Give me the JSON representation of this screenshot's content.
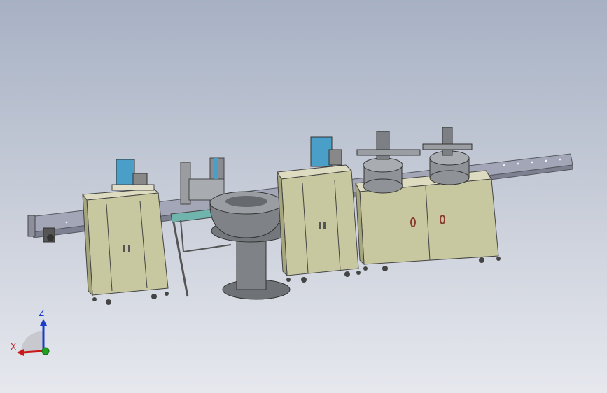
{
  "viewport": {
    "triad": {
      "z_label": "Z",
      "x_label": "X",
      "z_color": "#1a3cc8",
      "x_color": "#c81a1a",
      "y_color": "#1fa01f"
    }
  },
  "colors": {
    "cabinet": "#c8c8a0",
    "cabinet_dark": "#a6a67e",
    "conveyor": "#9c9fb0",
    "machine": "#8f9296",
    "accent_blue": "#4a9fc8",
    "feeder": "#7f8286",
    "table_top": "#6fb5ae"
  }
}
